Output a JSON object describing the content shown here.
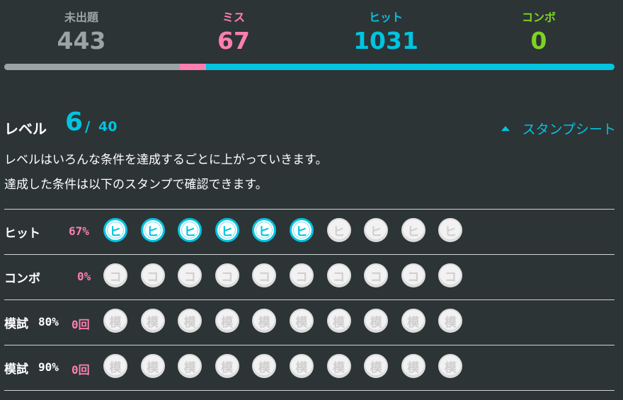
{
  "stats": {
    "unanswered": {
      "label": "未出題",
      "value": "443",
      "color": "#9ba3a5"
    },
    "miss": {
      "label": "ミス",
      "value": "67",
      "color": "#ff7eb0"
    },
    "hit": {
      "label": "ヒット",
      "value": "1031",
      "color": "#00c4e0"
    },
    "combo": {
      "label": "コンボ",
      "value": "0",
      "color": "#7ed321"
    }
  },
  "progress": {
    "unanswered": 443,
    "miss": 67,
    "hit": 1031
  },
  "level": {
    "label": "レベル",
    "value": "6",
    "sep": "/",
    "max": "40"
  },
  "stamp_sheet_link": "スタンプシート",
  "description": [
    "レベルはいろんな条件を達成するごとに上がっていきます。",
    "達成した条件は以下のスタンプで確認できます。"
  ],
  "conditions": [
    {
      "name": "ヒット",
      "threshold": "",
      "progress": "67%",
      "glyph": "ヒ",
      "total": 10,
      "achieved": 6
    },
    {
      "name": "コンボ",
      "threshold": "",
      "progress": "0%",
      "glyph": "コ",
      "total": 10,
      "achieved": 0
    },
    {
      "name": "模試",
      "threshold": "80%",
      "progress": "0回",
      "glyph": "模",
      "total": 10,
      "achieved": 0
    },
    {
      "name": "模試",
      "threshold": "90%",
      "progress": "0回",
      "glyph": "模",
      "total": 10,
      "achieved": 0
    }
  ]
}
